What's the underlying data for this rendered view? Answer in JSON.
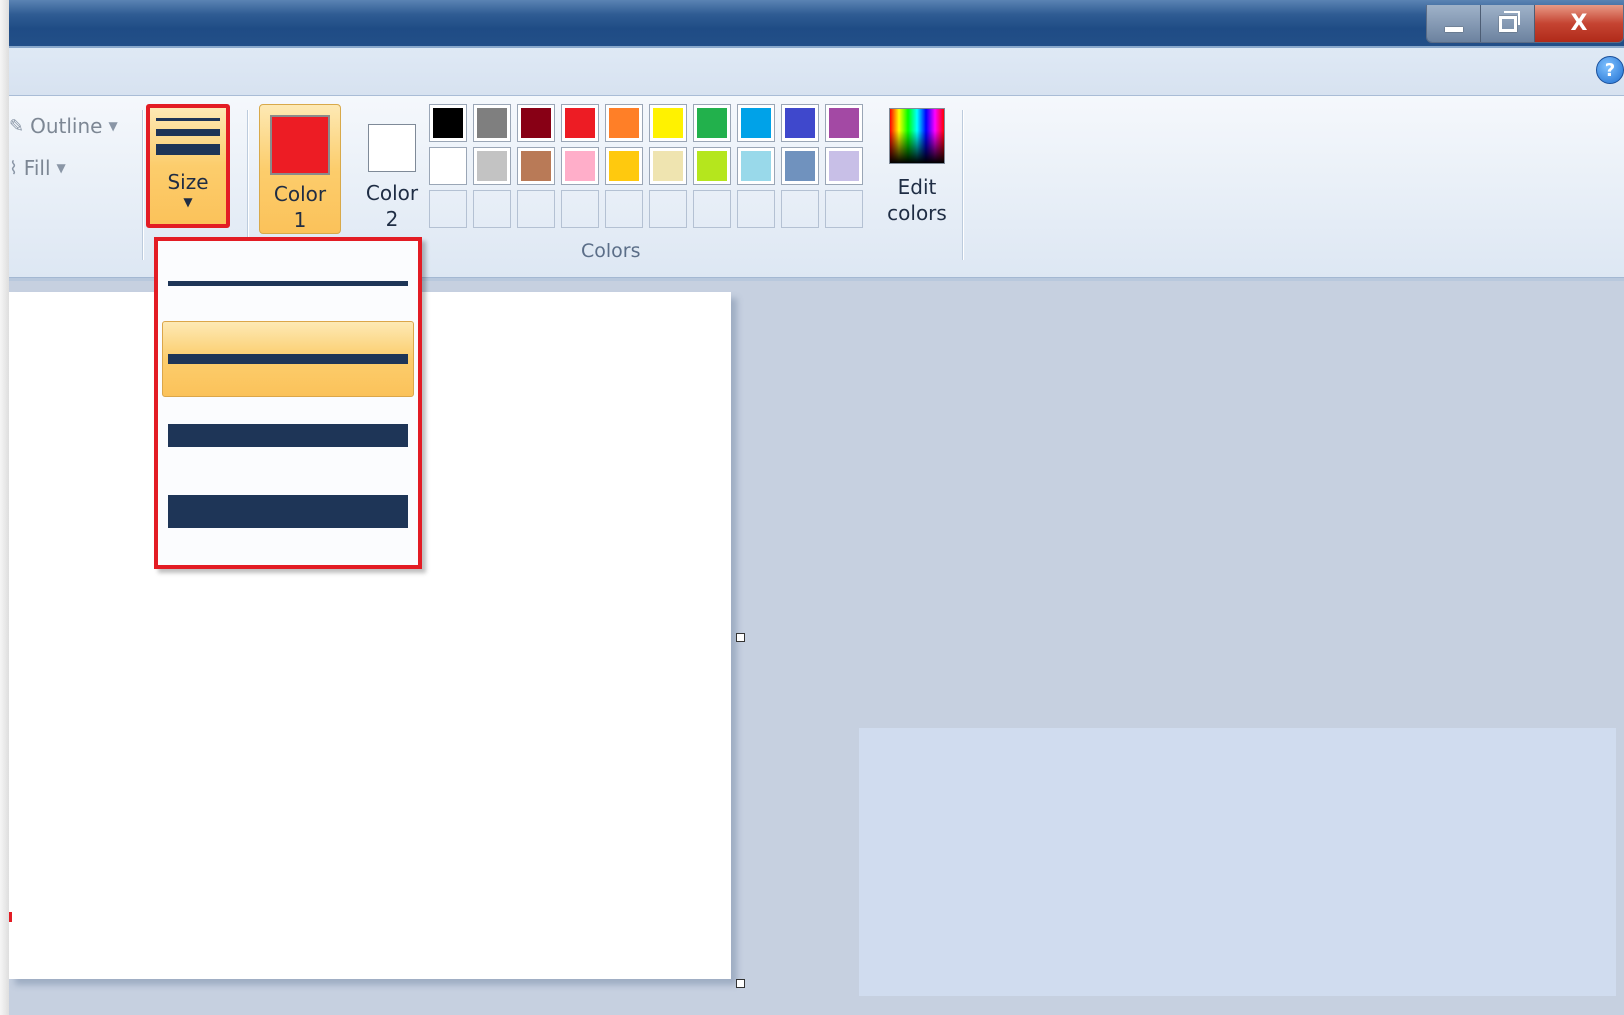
{
  "ribbon": {
    "outline_label": "Outline",
    "fill_label": "Fill",
    "size_label": "Size",
    "color1_label": "Color\n1",
    "color1_line1": "Color",
    "color1_line2": "1",
    "color2_line1": "Color",
    "color2_line2": "2",
    "color1_value": "#ed1c24",
    "color2_value": "#ffffff",
    "colors_group_label": "Colors",
    "edit_colors_line1": "Edit",
    "edit_colors_line2": "colors"
  },
  "palette": {
    "row1": [
      "#000000",
      "#7f7f7f",
      "#880015",
      "#ed1c24",
      "#ff7f27",
      "#fff200",
      "#22b14c",
      "#00a2e8",
      "#3f48cc",
      "#a349a4"
    ],
    "row2": [
      "#ffffff",
      "#c3c3c3",
      "#b97a57",
      "#ffaec9",
      "#ffc90e",
      "#efe4b0",
      "#b5e61d",
      "#99d9ea",
      "#7092be",
      "#c8bfe7"
    ],
    "row3_empty_count": 10
  },
  "size_dropdown": {
    "options": [
      "size-1px",
      "size-3px",
      "size-5px",
      "size-8px"
    ],
    "selected_index": 1
  },
  "titlebar": {
    "minimize_icon": "minimize-icon",
    "restore_icon": "restore-icon",
    "close_glyph": "X"
  },
  "help": {
    "glyph": "?"
  }
}
